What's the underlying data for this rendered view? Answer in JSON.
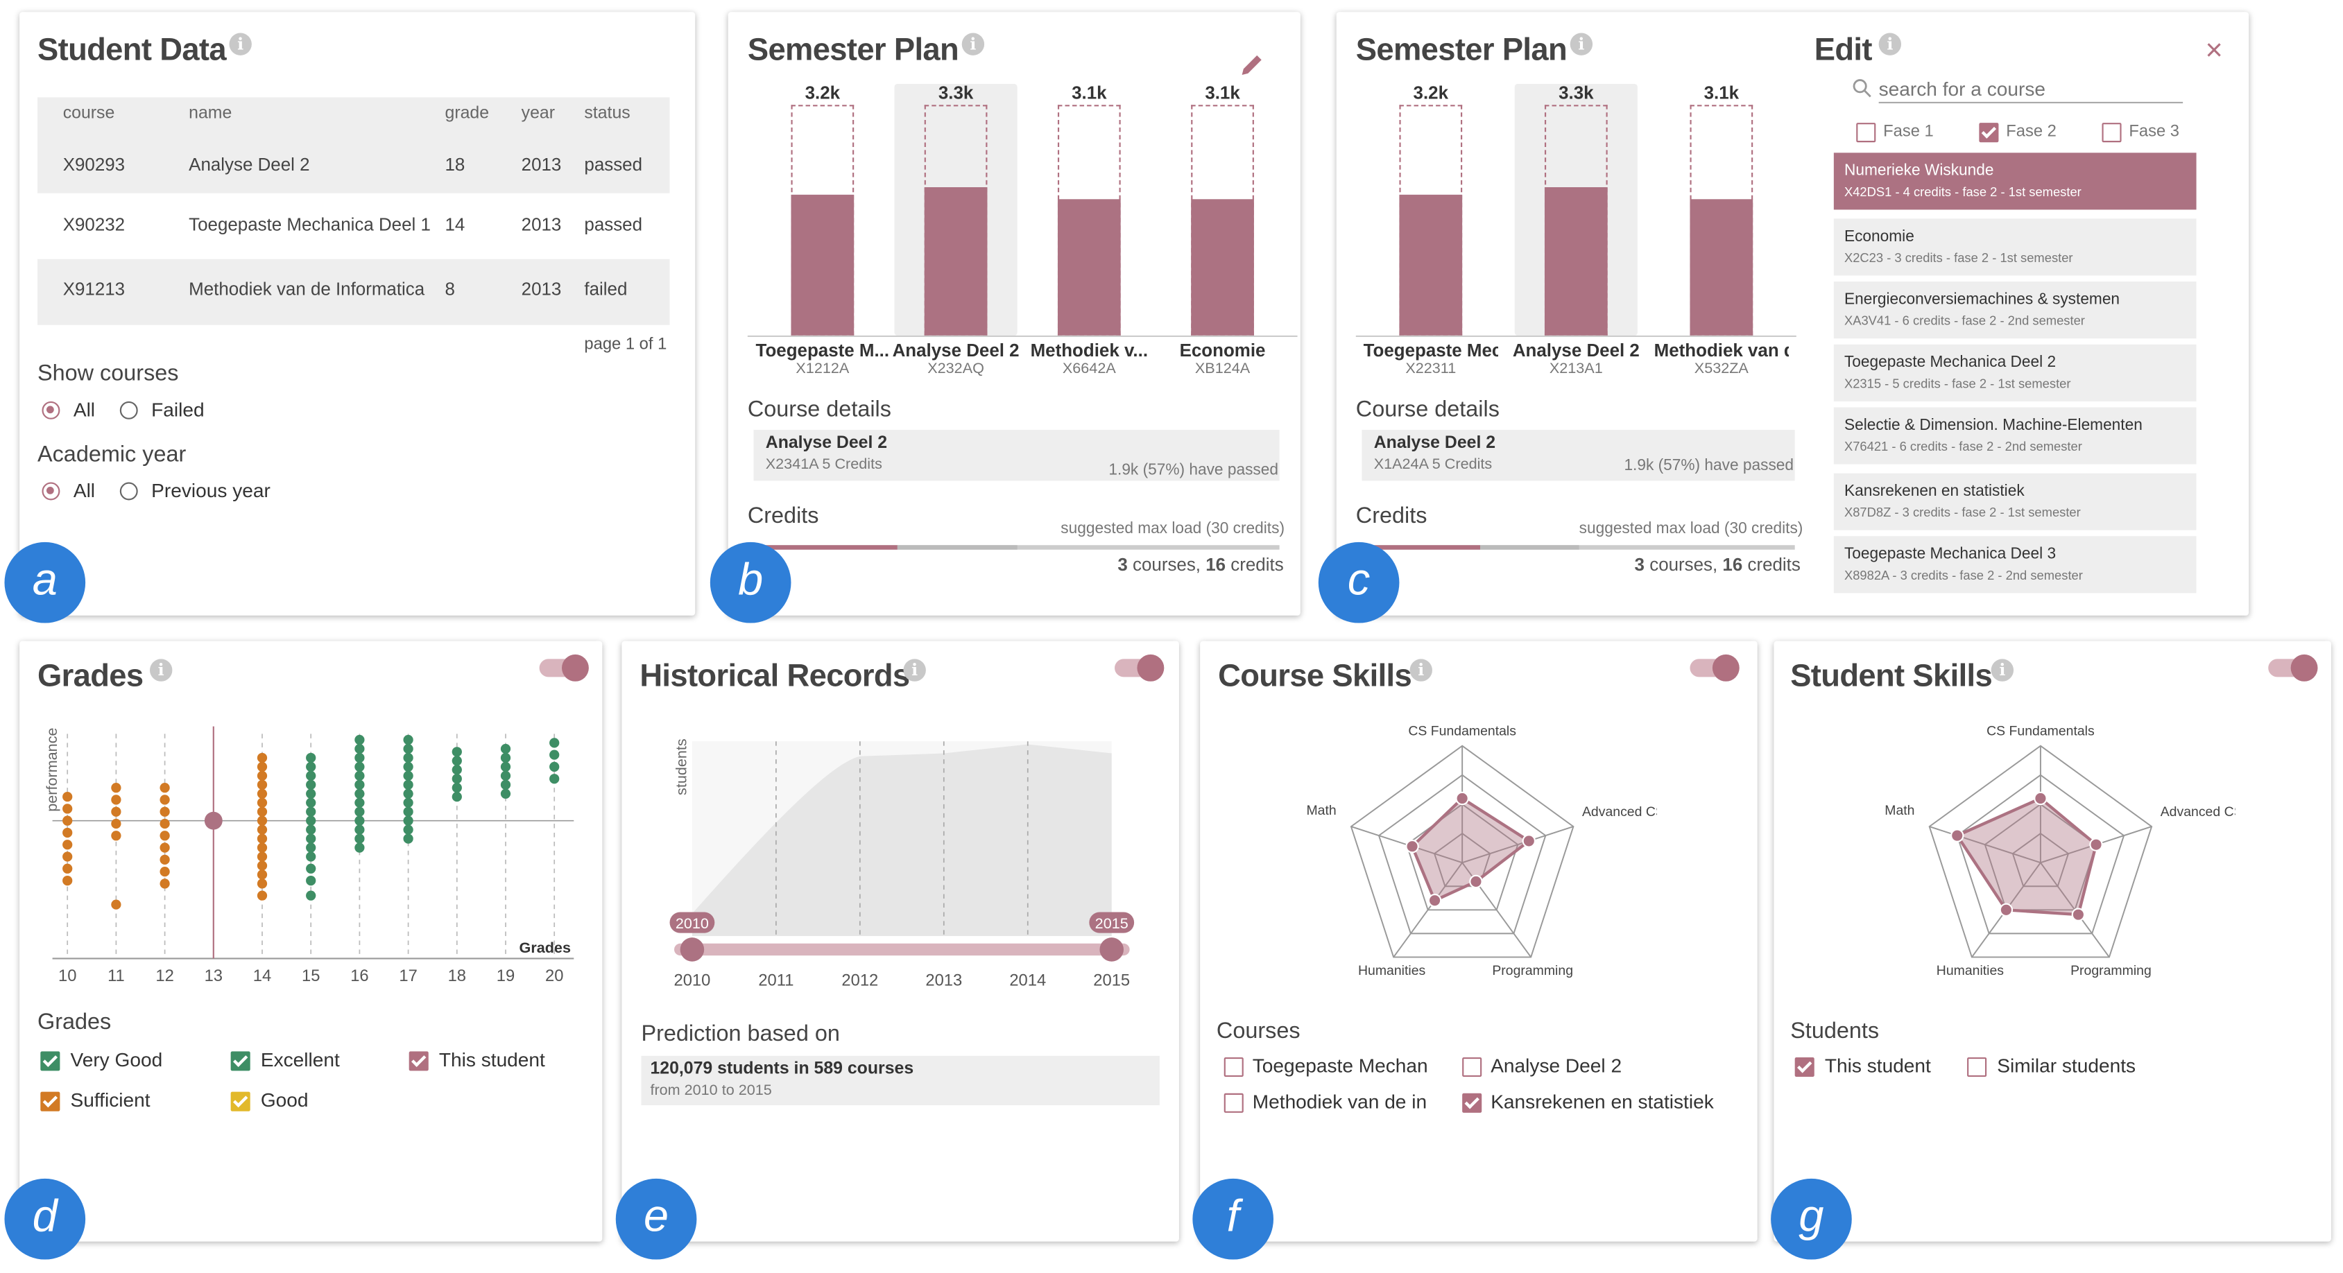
{
  "colors": {
    "accent": "#ac7282",
    "badge": "#2f7fd8",
    "green": "#3e8e65",
    "orange": "#d27a24",
    "yellow": "#e2b92b"
  },
  "student_data": {
    "title": "Student Data",
    "badge": "a",
    "columns": [
      "course",
      "name",
      "grade",
      "year",
      "status"
    ],
    "rows": [
      [
        "X90293",
        "Analyse Deel 2",
        "18",
        "2013",
        "passed"
      ],
      [
        "X90232",
        "Toegepaste Mechanica Deel 1",
        "14",
        "2013",
        "passed"
      ],
      [
        "X91213",
        "Methodiek van de Informatica",
        "8",
        "2013",
        "failed"
      ]
    ],
    "pagination": "page 1 of 1",
    "show_courses": {
      "label": "Show courses",
      "options": [
        "All",
        "Failed"
      ],
      "selected": "All"
    },
    "academic_year": {
      "label": "Academic year",
      "options": [
        "All",
        "Previous year"
      ],
      "selected": "All"
    }
  },
  "semester_plan_b": {
    "title": "Semester Plan",
    "badge": "b",
    "bars": [
      {
        "value_label": "3.2k",
        "name": "Toegepaste M...",
        "code": "X1212A",
        "fill": 0.61
      },
      {
        "value_label": "3.3k",
        "name": "Analyse Deel 2",
        "code": "X232AQ",
        "fill": 0.64
      },
      {
        "value_label": "3.1k",
        "name": "Methodiek v...",
        "code": "X6642A",
        "fill": 0.59
      },
      {
        "value_label": "3.1k",
        "name": "Economie",
        "code": "XB124A",
        "fill": 0.59
      }
    ],
    "details_label": "Course details",
    "detail": {
      "name": "Analyse Deel 2",
      "meta": "X2341A 5 Credits",
      "passed": "1.9k (57%) have passed"
    },
    "credits_label": "Credits",
    "max_load": "suggested max load (30 credits)",
    "summary_courses": "3",
    "summary_courses_word": "courses,",
    "summary_credits": "16",
    "summary_credits_word": "credits"
  },
  "semester_plan_c": {
    "title": "Semester Plan",
    "badge": "c",
    "bars": [
      {
        "value_label": "3.2k",
        "name": "Toegepaste Mech",
        "code": "X22311",
        "fill": 0.61
      },
      {
        "value_label": "3.3k",
        "name": "Analyse Deel 2",
        "code": "X213A1",
        "fill": 0.64
      },
      {
        "value_label": "3.1k",
        "name": "Methodiek van de...",
        "code": "X532ZA",
        "fill": 0.59
      }
    ],
    "details_label": "Course details",
    "detail": {
      "name": "Analyse Deel 2",
      "meta": "X1A24A 5 Credits",
      "passed": "1.9k (57%) have passed"
    },
    "credits_label": "Credits",
    "max_load": "suggested max load (30 credits)",
    "summary_courses": "3",
    "summary_courses_word": "courses,",
    "summary_credits": "16",
    "summary_credits_word": "credits"
  },
  "edit": {
    "title": "Edit",
    "search_placeholder": "search for a course",
    "filters": [
      {
        "label": "Fase 1",
        "checked": false
      },
      {
        "label": "Fase 2",
        "checked": true
      },
      {
        "label": "Fase 3",
        "checked": false
      }
    ],
    "courses": [
      {
        "name": "Numerieke Wiskunde",
        "meta": "X42DS1 - 4 credits - fase 2 - 1st semester",
        "selected": true
      },
      {
        "name": "Economie",
        "meta": "X2C23 - 3 credits - fase 2 - 1st semester"
      },
      {
        "name": "Energieconversiemachines & systemen",
        "meta": "XA3V41 - 6 credits - fase 2 - 2nd semester"
      },
      {
        "name": "Toegepaste Mechanica Deel 2",
        "meta": "X2315 - 5 credits - fase 2 - 1st semester"
      },
      {
        "name": "Selectie & Dimension. Machine-Elementen",
        "meta": "X76421 - 6 credits - fase 2 - 2nd semester"
      },
      {
        "name": "Kansrekenen en statistiek",
        "meta": "X87D8Z - 3 credits - fase 2 - 1st semester"
      },
      {
        "name": "Toegepaste Mechanica Deel 3",
        "meta": "X8982A - 3 credits - fase 2 - 2nd semester"
      }
    ]
  },
  "grades": {
    "title": "Grades",
    "badge": "d",
    "ylabel": "performance",
    "xlabel": "Grades",
    "ticks": [
      "10",
      "11",
      "12",
      "13",
      "14",
      "15",
      "16",
      "17",
      "18",
      "19",
      "20"
    ],
    "legend_title": "Grades",
    "legend": [
      {
        "label": "Very Good",
        "color": "green"
      },
      {
        "label": "Excellent",
        "color": "green"
      },
      {
        "label": "This student",
        "color": "accent"
      },
      {
        "label": "Sufficient",
        "color": "orange"
      },
      {
        "label": "Good",
        "color": "yellow"
      }
    ]
  },
  "historical": {
    "title": "Historical Records",
    "badge": "e",
    "ylabel": "students",
    "years": [
      "2010",
      "2011",
      "2012",
      "2013",
      "2014",
      "2015"
    ],
    "range_start": "2010",
    "range_end": "2015",
    "prediction_label": "Prediction based on",
    "prediction_main": "120,079 students in 589 courses",
    "prediction_sub": "from 2010 to 2015"
  },
  "course_skills": {
    "title": "Course Skills",
    "badge": "f",
    "axes": [
      "CS Fundamentals",
      "Advanced CS Topics",
      "Programming",
      "Humanities",
      "Math"
    ],
    "values": [
      0.55,
      0.6,
      0.2,
      0.4,
      0.45
    ],
    "list_label": "Courses",
    "items": [
      {
        "label": "Toegepaste Mechan",
        "checked": false
      },
      {
        "label": "Analyse Deel 2",
        "checked": false
      },
      {
        "label": "Methodiek van de in",
        "checked": false
      },
      {
        "label": "Kansrekenen en statistiek",
        "checked": true
      }
    ]
  },
  "student_skills": {
    "title": "Student Skills",
    "badge": "g",
    "axes": [
      "CS Fundamentals",
      "Advanced CS Topics",
      "Programming",
      "Humanities",
      "Math"
    ],
    "values": [
      0.55,
      0.5,
      0.55,
      0.5,
      0.75
    ],
    "list_label": "Students",
    "items": [
      {
        "label": "This student",
        "checked": true
      },
      {
        "label": "Similar students",
        "checked": false
      }
    ]
  }
}
